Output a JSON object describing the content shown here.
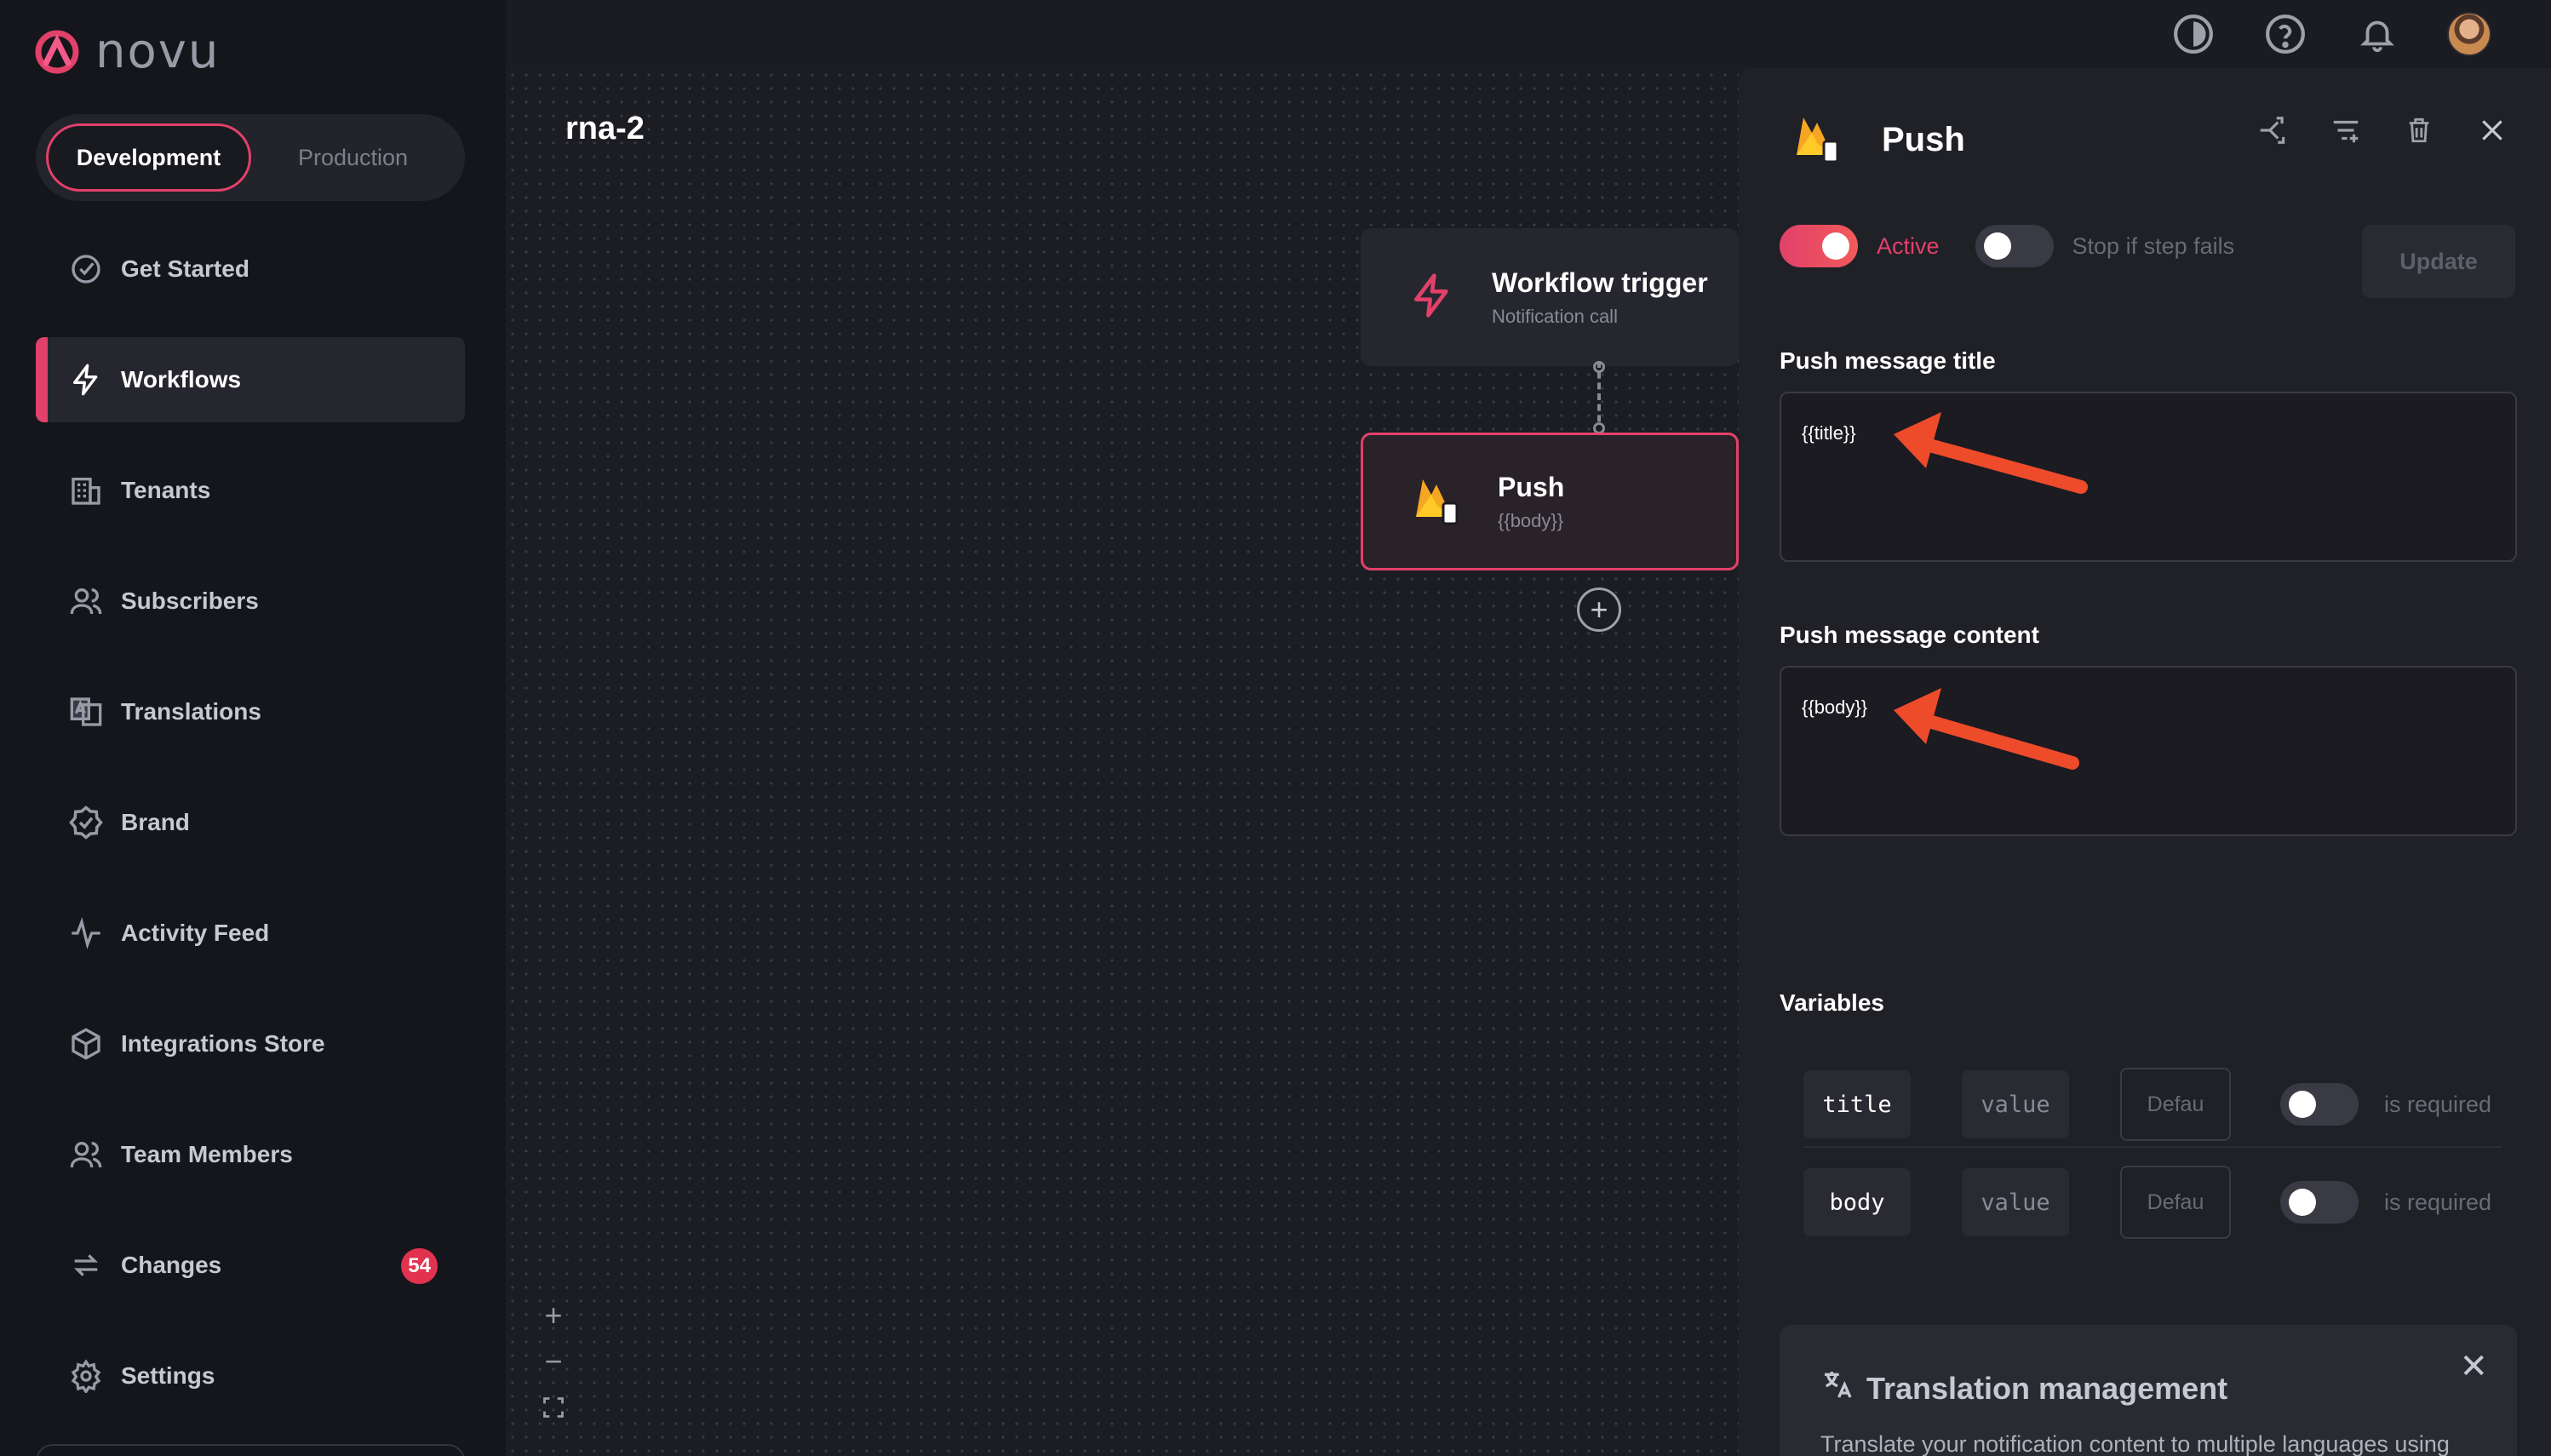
{
  "app": {
    "brand": "novu"
  },
  "environment": {
    "development": "Development",
    "production": "Production"
  },
  "sidebar": {
    "items": [
      {
        "label": "Get Started",
        "icon": "check-circle-icon"
      },
      {
        "label": "Workflows",
        "icon": "bolt-icon",
        "active": true
      },
      {
        "label": "Tenants",
        "icon": "building-icon"
      },
      {
        "label": "Subscribers",
        "icon": "users-icon"
      },
      {
        "label": "Translations",
        "icon": "translate-icon"
      },
      {
        "label": "Brand",
        "icon": "badge-check-icon"
      },
      {
        "label": "Activity Feed",
        "icon": "activity-icon"
      },
      {
        "label": "Integrations Store",
        "icon": "box-icon"
      },
      {
        "label": "Team Members",
        "icon": "team-icon"
      },
      {
        "label": "Changes",
        "icon": "changes-icon",
        "badge": "54"
      },
      {
        "label": "Settings",
        "icon": "gear-icon"
      }
    ]
  },
  "topbar": {
    "icons": [
      "theme-toggle-icon",
      "help-icon",
      "bell-icon",
      "avatar"
    ]
  },
  "workflow": {
    "name": "rna-2",
    "trigger": {
      "title": "Workflow trigger",
      "subtitle": "Notification call"
    },
    "push": {
      "title": "Push",
      "subtitle": "{{body}}"
    }
  },
  "panel": {
    "title": "Push",
    "active_label": "Active",
    "stop_label": "Stop if step fails",
    "update_label": "Update",
    "title_field": {
      "label": "Push message title",
      "value": "{{title}}"
    },
    "content_field": {
      "label": "Push message content",
      "value": "{{body}}"
    },
    "variables_label": "Variables",
    "variables": [
      {
        "name": "title",
        "type": "value",
        "default_placeholder": "Defau",
        "required_label": "is required"
      },
      {
        "name": "body",
        "type": "value",
        "default_placeholder": "Defau",
        "required_label": "is required"
      }
    ],
    "translation": {
      "title": "Translation management",
      "text": "Translate your notification content to multiple languages using"
    }
  },
  "colors": {
    "accent": "#e1416a",
    "annotation_arrow": "#ee4b2b",
    "background": "#1b1b22"
  }
}
